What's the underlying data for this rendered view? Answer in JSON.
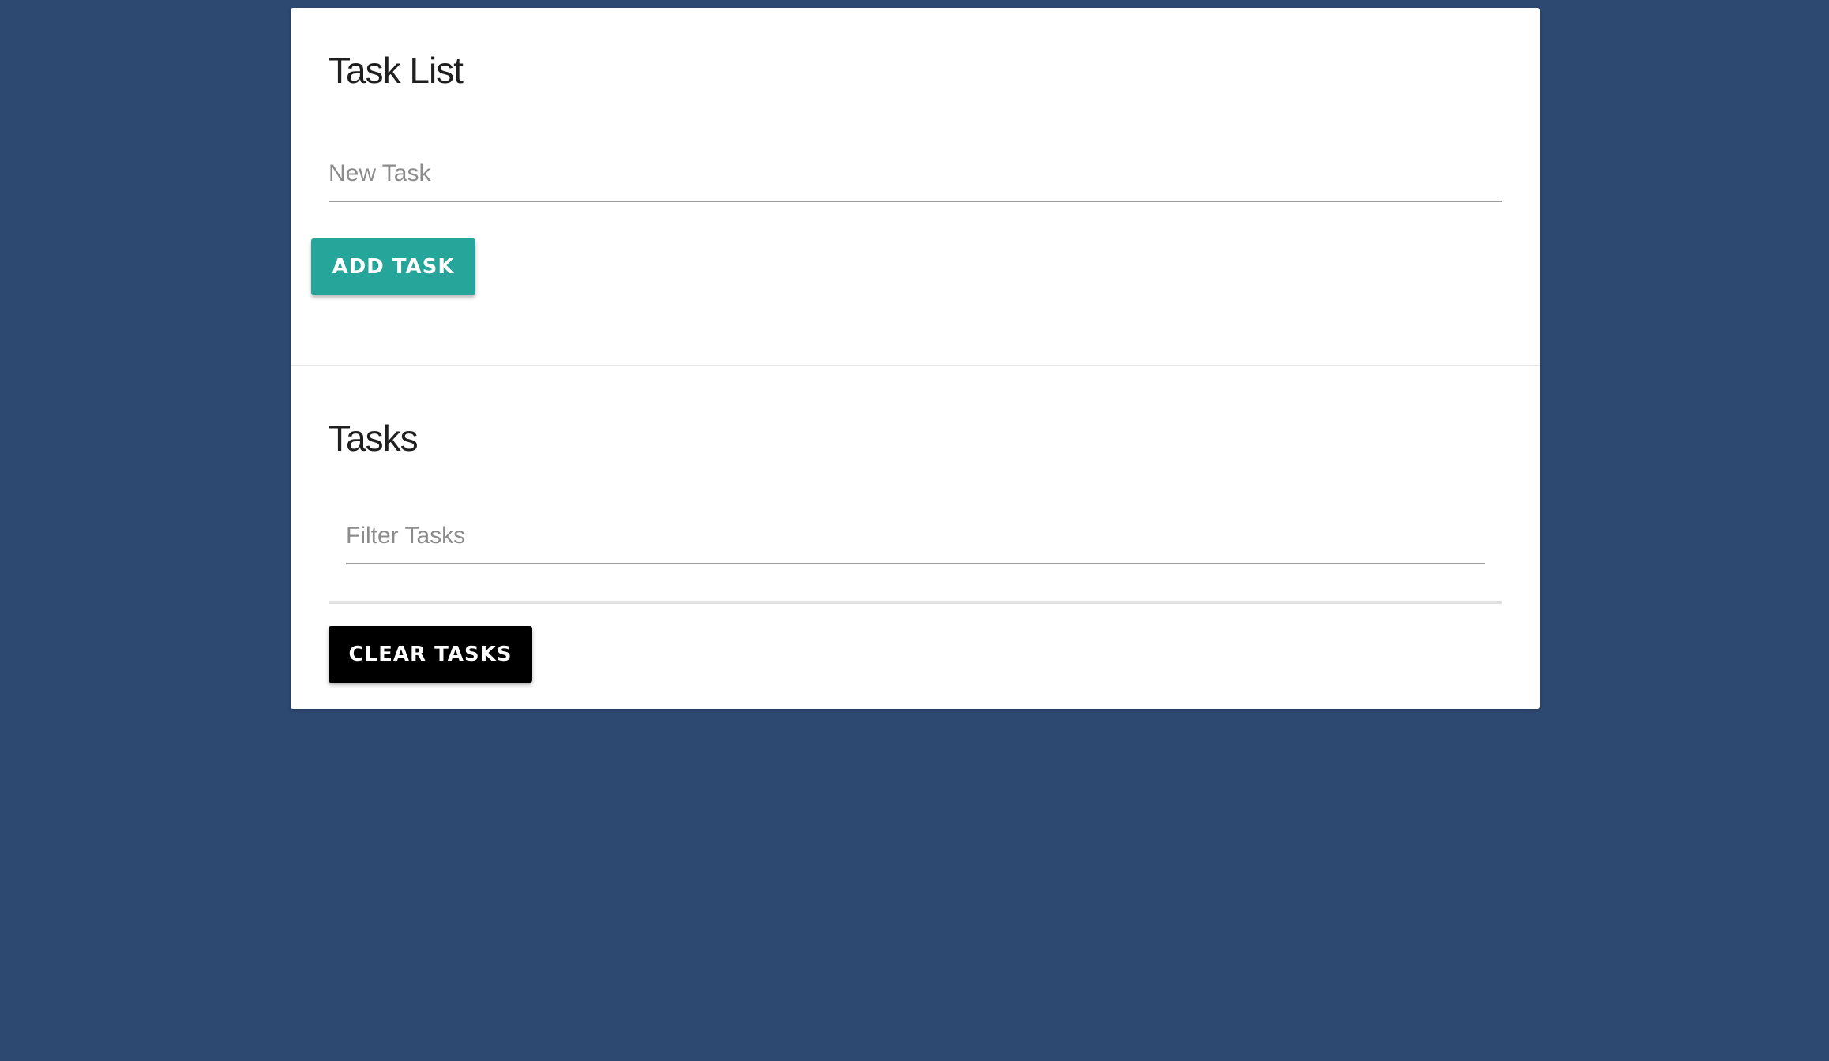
{
  "top_section": {
    "title": "Task List",
    "task_input": {
      "placeholder": "New Task",
      "value": ""
    },
    "add_button_label": "ADD TASK"
  },
  "tasks_section": {
    "title": "Tasks",
    "filter_input": {
      "placeholder": "Filter Tasks",
      "value": ""
    },
    "tasks": [],
    "clear_button_label": "CLEAR TASKS"
  },
  "colors": {
    "background": "#2d4871",
    "card": "#ffffff",
    "add_button": "#26a69a",
    "clear_button": "#000000"
  }
}
